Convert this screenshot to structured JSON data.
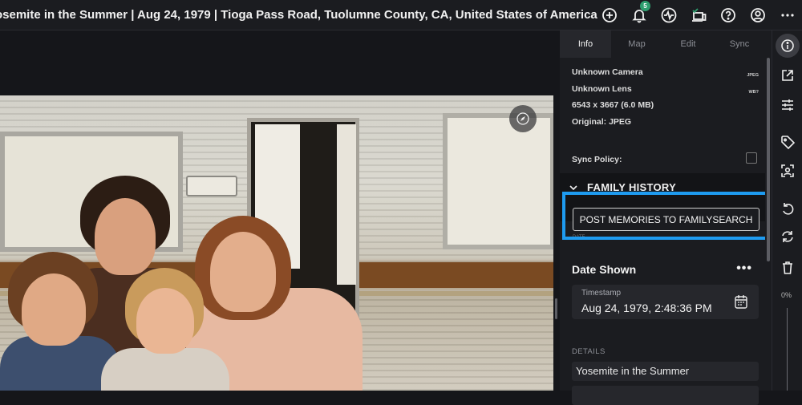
{
  "header": {
    "title": "osemite in the Summer | Aug 24, 1979 | Tioga Pass Road, Tuolumne County, CA, United States of America",
    "notification_count": "5"
  },
  "icons": {
    "top": [
      "add-circle-icon",
      "bell-icon",
      "activity-icon",
      "devices-sync-icon",
      "help-icon",
      "account-icon",
      "more-icon"
    ],
    "rail": [
      "info-icon",
      "open-external-icon",
      "adjust-icon",
      "tag-icon",
      "face-icon",
      "rotate-left-icon",
      "rotate-right-icon",
      "trash-icon"
    ]
  },
  "panel": {
    "tabs": [
      "Info",
      "Map",
      "Edit",
      "Sync"
    ],
    "active_tab": "Info",
    "camera": "Unknown Camera",
    "camera_tag": "JPEG",
    "lens": "Unknown Lens",
    "lens_tag": "WB?",
    "dimensions": "6543 x 3667 (6.0 MB)",
    "original": "Original: JPEG",
    "sync_policy": "Sync Policy:",
    "family_history": "FAMILY HISTORY",
    "post_button": "POST MEMORIES TO FAMILYSEARCH",
    "date_small": "DATE",
    "date_shown": "Date Shown",
    "more": "•••",
    "timestamp_label": "Timestamp",
    "timestamp_value": "Aug 24, 1979, 2:48:36 PM",
    "details_label": "DETAILS",
    "details_title": "Yosemite in the Summer"
  },
  "rail": {
    "zoom": "0%"
  },
  "colors": {
    "highlight": "#1e9bf0",
    "badge": "#2e9e6f",
    "background": "#15161a"
  }
}
